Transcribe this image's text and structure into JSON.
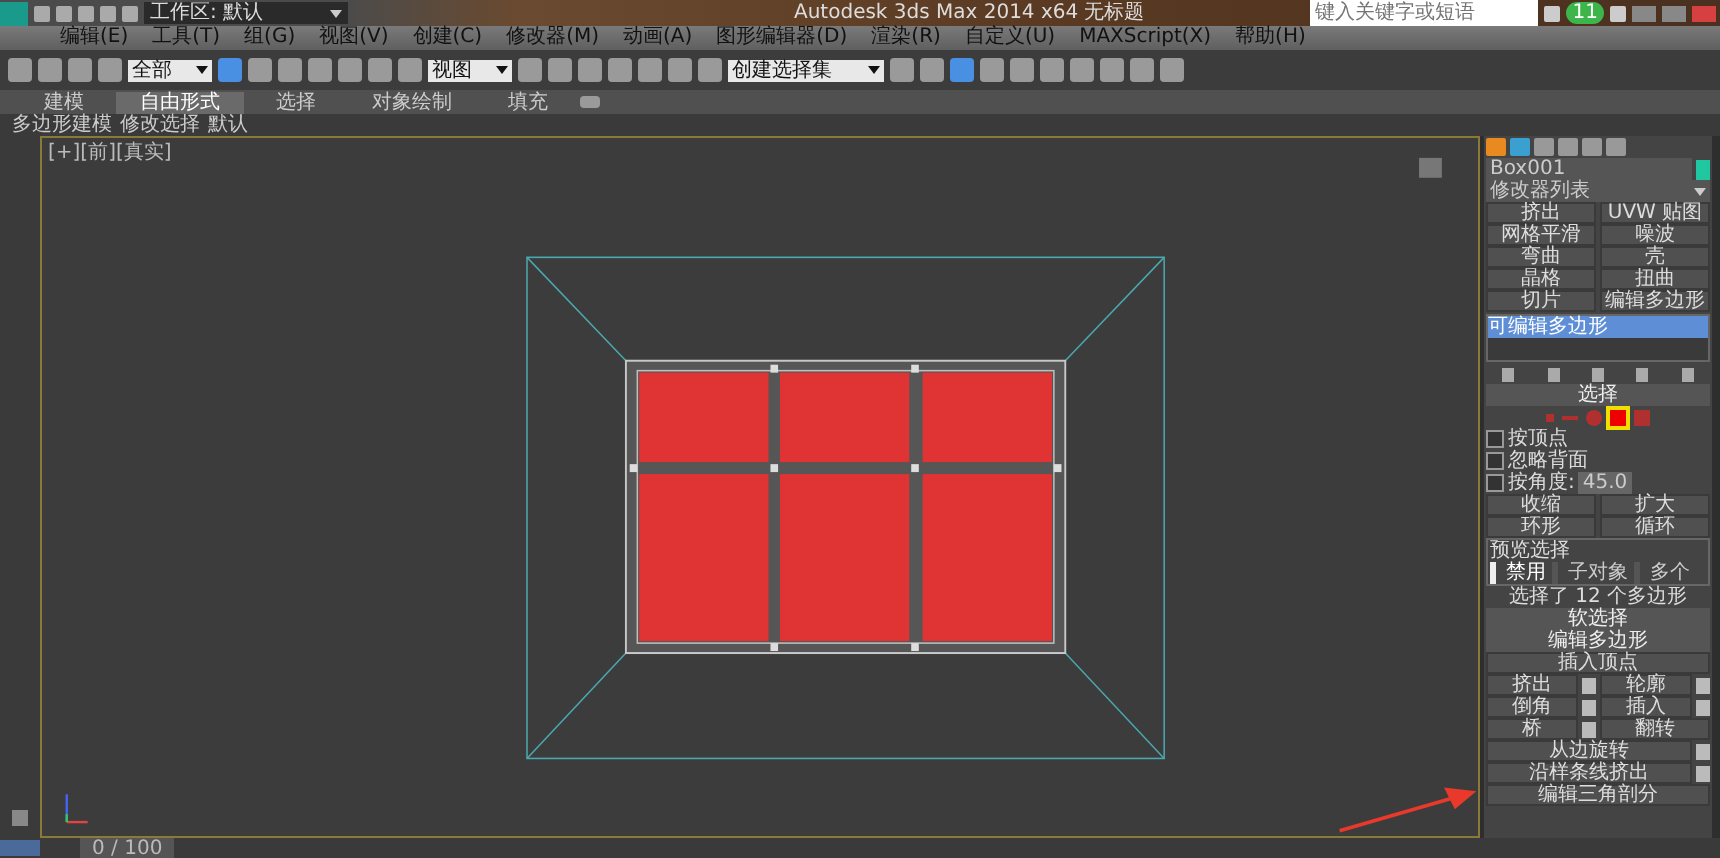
{
  "title_bar": {
    "workspace": "工作区: 默认",
    "title": "Autodesk 3ds Max 2014 x64",
    "document": "无标题",
    "search": {
      "placeholder": "键入关键字或短语"
    },
    "badge": "11"
  },
  "menu": [
    "编辑(E)",
    "工具(T)",
    "组(G)",
    "视图(V)",
    "创建(C)",
    "修改器(M)",
    "动画(A)",
    "图形编辑器(D)",
    "渲染(R)",
    "自定义(U)",
    "MAXScript(X)",
    "帮助(H)"
  ],
  "toolbar": {
    "filter": "全部",
    "coord": "视图",
    "selection_set": "创建选择集"
  },
  "ribbon": {
    "tabs": [
      {
        "label": "建模",
        "selected": false
      },
      {
        "label": "自由形式",
        "selected": true
      },
      {
        "label": "选择",
        "selected": false
      },
      {
        "label": "对象绘制",
        "selected": false
      },
      {
        "label": "填充",
        "selected": false
      }
    ],
    "subtabs": [
      "多边形建模",
      "修改选择",
      "默认"
    ]
  },
  "viewport": {
    "label": "[+][前][真实]"
  },
  "command_panel": {
    "object_name": "Box001",
    "modifier_list": "修改器列表",
    "modifier_buttons": [
      "挤出",
      "UVW 贴图",
      "网格平滑",
      "噪波",
      "弯曲",
      "壳",
      "晶格",
      "扭曲",
      "切片",
      "编辑多边形"
    ],
    "stack": [
      {
        "label": "可编辑多边形",
        "selected": true
      }
    ],
    "selection": {
      "title": "选择",
      "levels": [
        {
          "kind": "vertex",
          "selected": false
        },
        {
          "kind": "edge",
          "selected": false
        },
        {
          "kind": "border",
          "selected": false
        },
        {
          "kind": "polygon",
          "selected": true
        },
        {
          "kind": "element",
          "selected": false
        }
      ],
      "options": [
        {
          "label": "按顶点",
          "checked": false
        },
        {
          "label": "忽略背面",
          "checked": false
        },
        {
          "label": "按角度:",
          "checked": false
        }
      ],
      "angle": "45.0",
      "buttons": [
        "收缩",
        "扩大"
      ],
      "spinners": [
        "环形",
        "循环"
      ],
      "preview": {
        "title": "预览选择",
        "options": [
          {
            "label": "禁用",
            "selected": true
          },
          {
            "label": "子对象",
            "selected": false
          },
          {
            "label": "多个",
            "selected": false
          }
        ]
      },
      "status": "选择了 12 个多边形"
    },
    "soft_selection": {
      "title": "软选择"
    },
    "edit_polygons": {
      "title": "编辑多边形",
      "insert_vertex": "插入顶点",
      "ops": [
        {
          "label": "挤出",
          "settings": true
        },
        {
          "label": "轮廓",
          "settings": true
        },
        {
          "label": "倒角",
          "settings": true
        },
        {
          "label": "插入",
          "settings": true
        },
        {
          "label": "桥",
          "settings": true
        },
        {
          "label": "翻转",
          "settings": false
        }
      ],
      "more": [
        {
          "label": "从边旋转",
          "settings": true
        },
        {
          "label": "沿样条线挤出",
          "settings": true
        },
        {
          "label": "编辑三角剖分",
          "settings": false
        }
      ]
    }
  },
  "timeline": {
    "frame": "0 / 100"
  }
}
